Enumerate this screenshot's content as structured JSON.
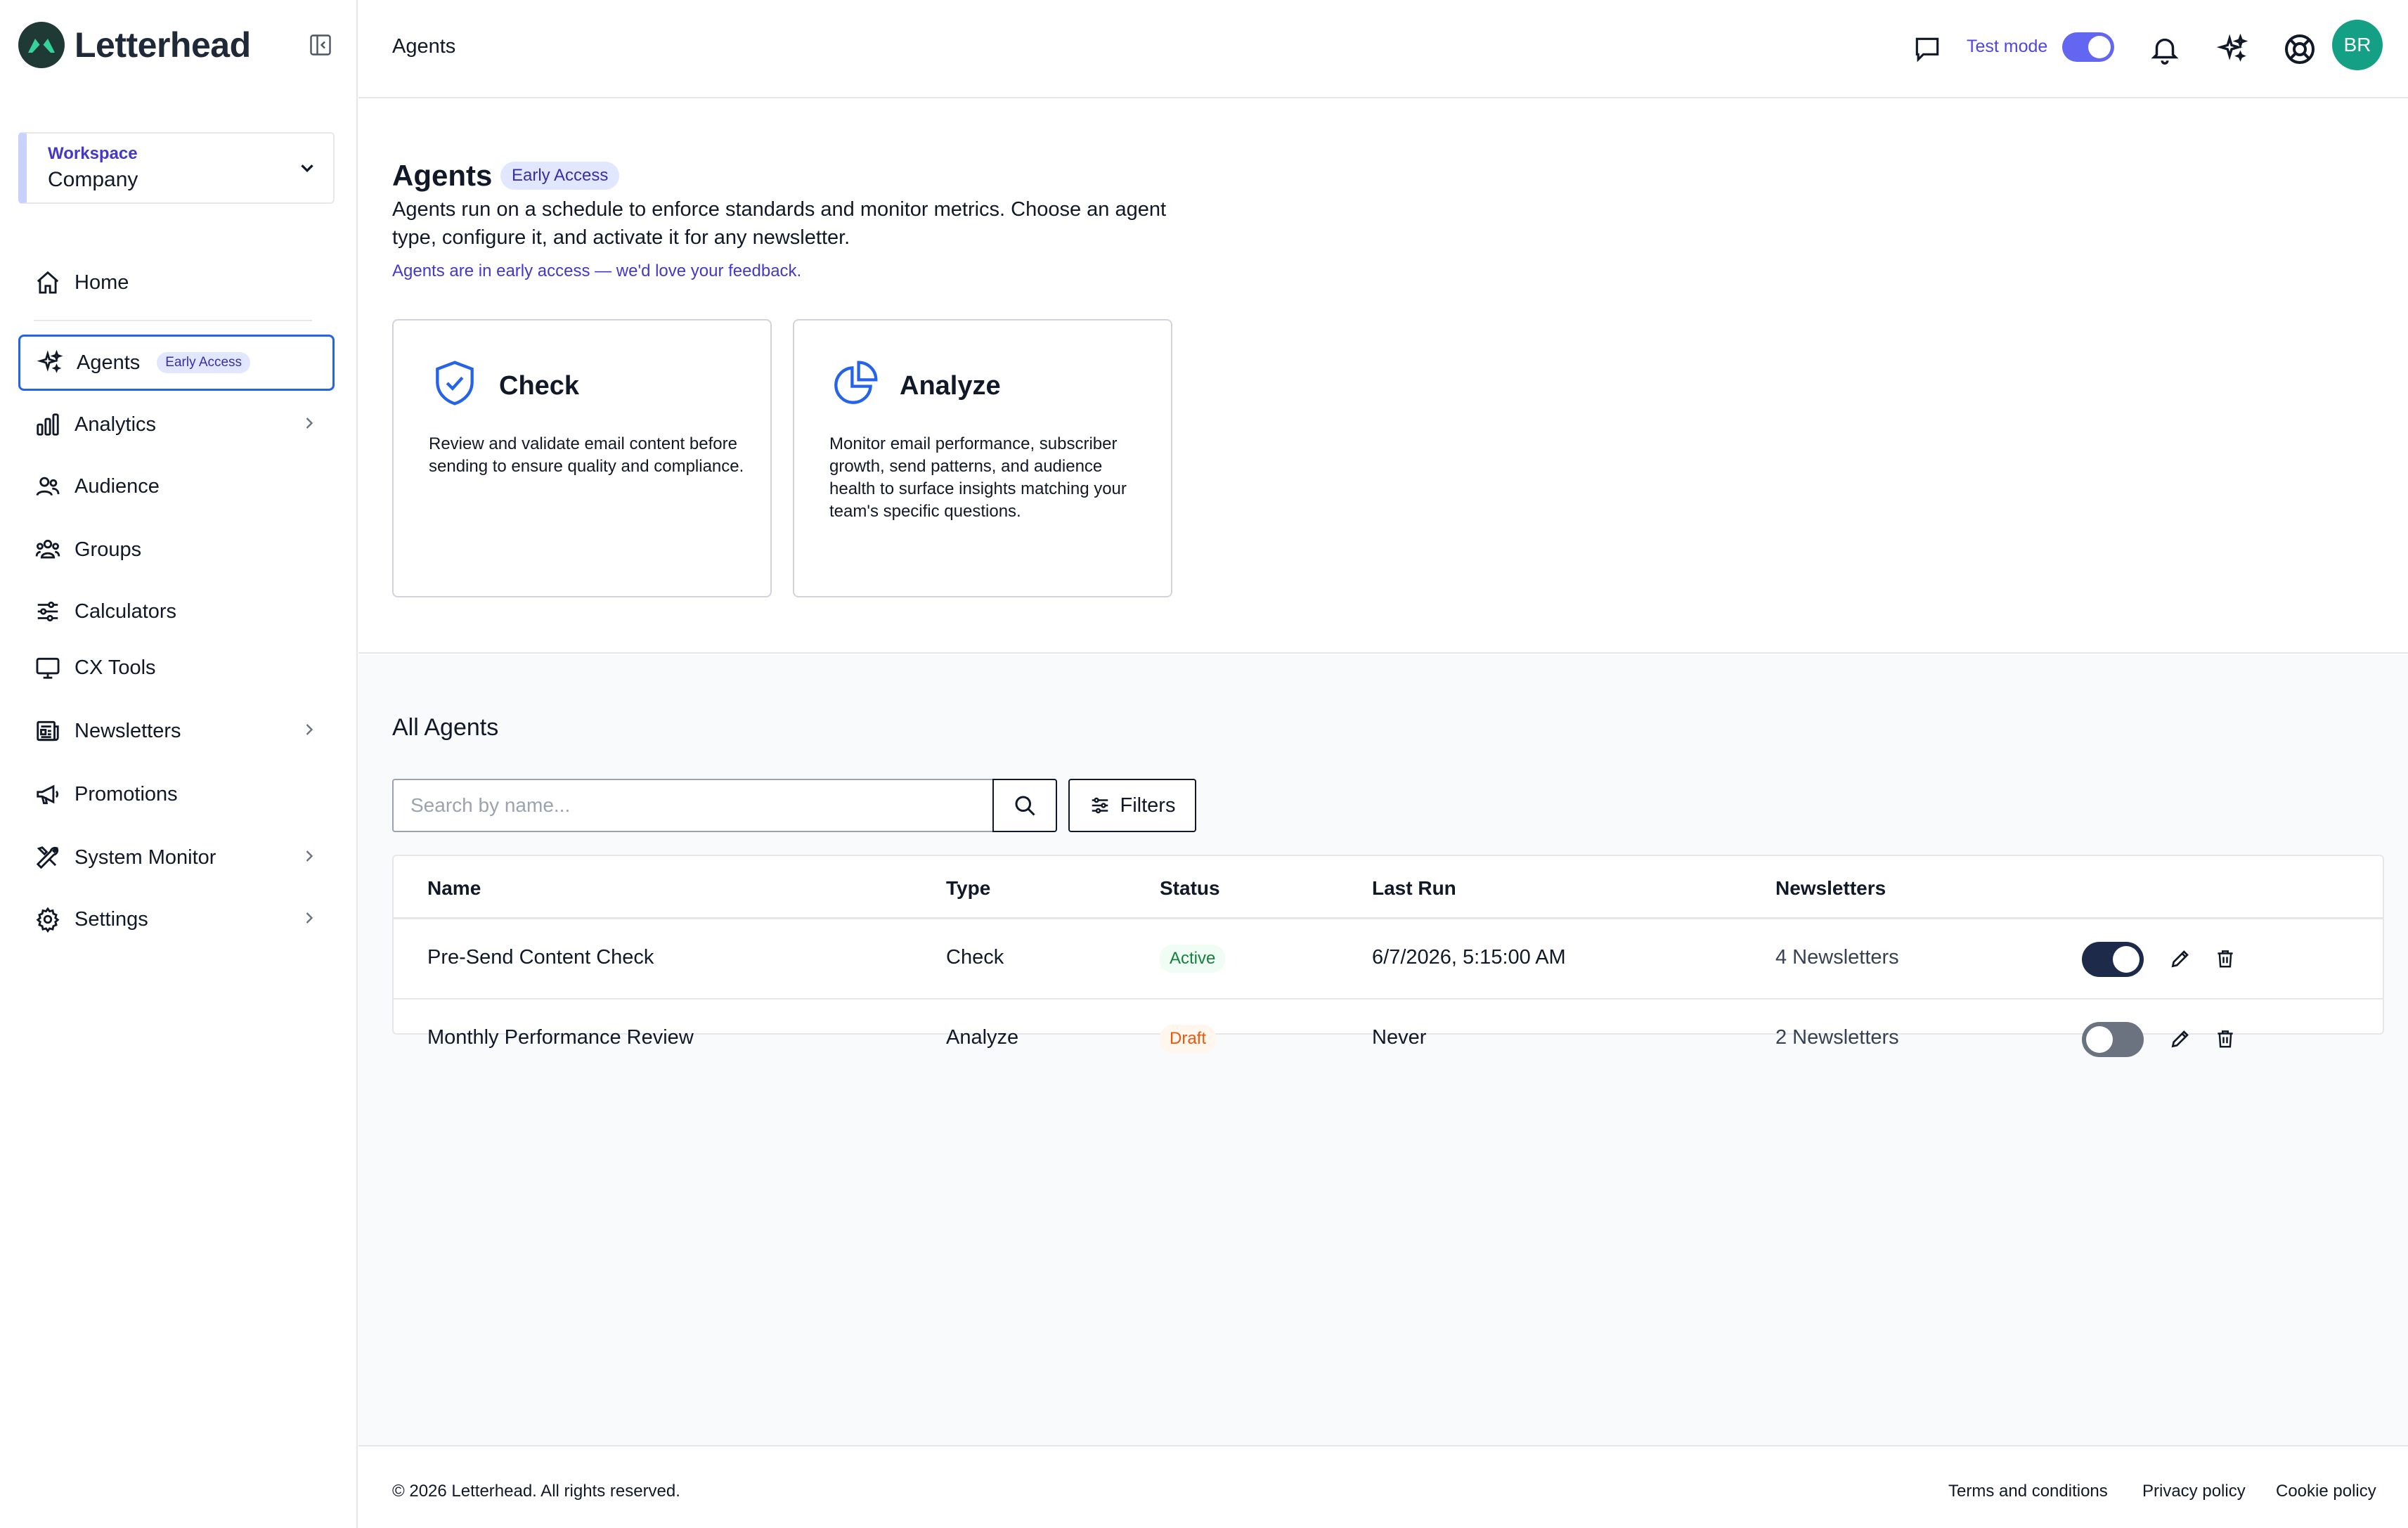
{
  "app": {
    "name": "Letterhead"
  },
  "workspace": {
    "label": "Workspace",
    "value": "Company"
  },
  "nav": {
    "home": "Home",
    "agents": "Agents",
    "agents_badge": "Early Access",
    "analytics": "Analytics",
    "audience": "Audience",
    "groups": "Groups",
    "calculators": "Calculators",
    "cx_tools": "CX Tools",
    "newsletters": "Newsletters",
    "promotions": "Promotions",
    "system_monitor": "System Monitor",
    "settings": "Settings"
  },
  "topbar": {
    "breadcrumb": "Agents",
    "test_mode_label": "Test mode",
    "test_mode_on": true,
    "avatar_initials": "BR"
  },
  "hero": {
    "title": "Agents",
    "badge": "Early Access",
    "description": "Agents run on a schedule to enforce standards and monitor metrics. Choose an agent type, configure it, and activate it for any newsletter.",
    "feedback_link": "Agents are in early access — we'd love your feedback.",
    "cards": [
      {
        "icon": "shield-check-icon",
        "title": "Check",
        "description": "Review and validate email content before sending to ensure quality and compliance."
      },
      {
        "icon": "pie-chart-icon",
        "title": "Analyze",
        "description": "Monitor email performance, subscriber growth, send patterns, and audience health to surface insights matching your team's specific questions."
      }
    ]
  },
  "agents_list": {
    "title": "All Agents",
    "search_placeholder": "Search by name...",
    "filters_label": "Filters",
    "columns": {
      "name": "Name",
      "type": "Type",
      "status": "Status",
      "last_run": "Last Run",
      "newsletters": "Newsletters"
    },
    "rows": [
      {
        "name": "Pre-Send Content Check",
        "type": "Check",
        "status": "Active",
        "last_run": "6/7/2026, 5:15:00 AM",
        "newsletters": "4 Newsletters",
        "enabled": true
      },
      {
        "name": "Monthly Performance Review",
        "type": "Analyze",
        "status": "Draft",
        "last_run": "Never",
        "newsletters": "2 Newsletters",
        "enabled": false
      }
    ]
  },
  "footer": {
    "copyright": "© 2026 Letterhead. All rights reserved.",
    "links": [
      "Terms and conditions",
      "Privacy policy",
      "Cookie policy"
    ]
  },
  "colors": {
    "brand_green": "#14a085",
    "accent_indigo": "#4f46e5",
    "active_border": "#2563eb",
    "status_active": "#15803d",
    "status_draft": "#ea580c"
  }
}
